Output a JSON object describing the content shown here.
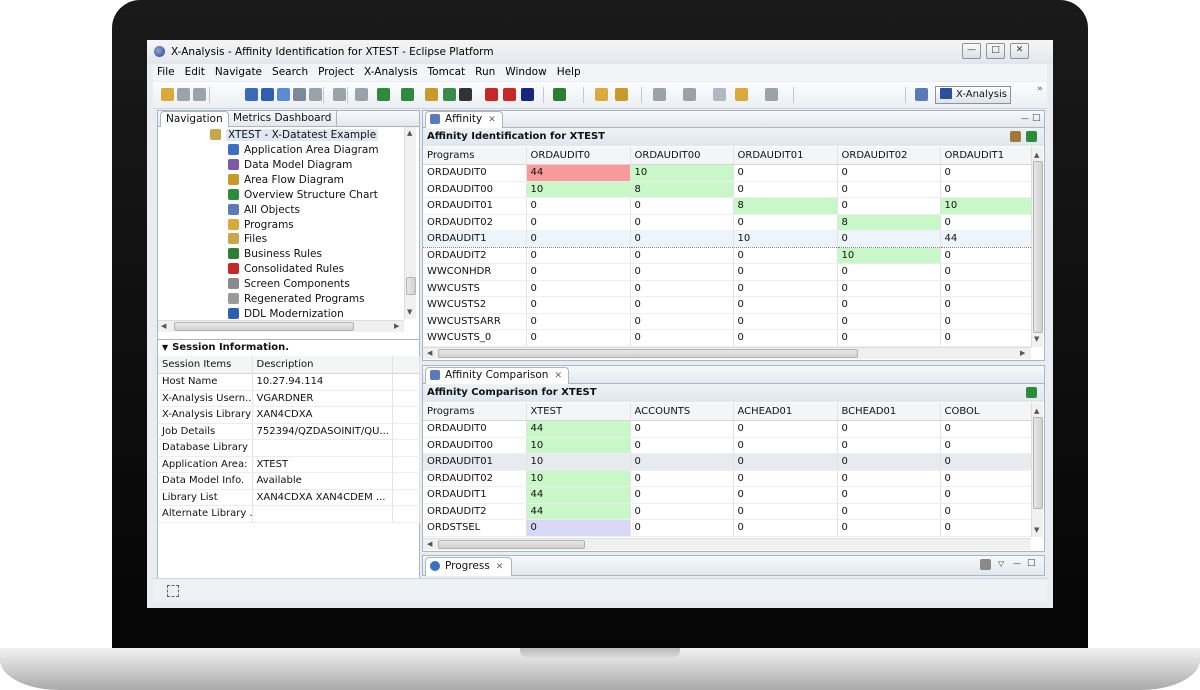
{
  "window": {
    "title": "X-Analysis - Affinity Identification for XTEST - Eclipse Platform"
  },
  "menu": [
    {
      "label": "File"
    },
    {
      "label": "Edit"
    },
    {
      "label": "Navigate"
    },
    {
      "label": "Search"
    },
    {
      "label": "Project"
    },
    {
      "label": "X-Analysis"
    },
    {
      "label": "Tomcat"
    },
    {
      "label": "Run"
    },
    {
      "label": "Window"
    },
    {
      "label": "Help"
    }
  ],
  "toolbar": {
    "perspective_label": "X-Analysis"
  },
  "navigation": {
    "tabs": [
      {
        "label": "Navigation"
      },
      {
        "label": "Metrics Dashboard"
      }
    ],
    "root": "XTEST - X-Datatest Example",
    "items": [
      {
        "label": "Application Area Diagram",
        "icon": "diagram-icon"
      },
      {
        "label": "Data Model Diagram",
        "icon": "data-model-icon"
      },
      {
        "label": "Area Flow Diagram",
        "icon": "flow-icon"
      },
      {
        "label": "Overview Structure Chart",
        "icon": "structure-icon"
      },
      {
        "label": "All Objects",
        "icon": "objects-icon"
      },
      {
        "label": "Programs",
        "icon": "programs-icon"
      },
      {
        "label": "Files",
        "icon": "files-icon"
      },
      {
        "label": "Business Rules",
        "icon": "rules-icon"
      },
      {
        "label": "Consolidated Rules",
        "icon": "consolidated-icon"
      },
      {
        "label": "Screen Components",
        "icon": "screen-icon"
      },
      {
        "label": "Regenerated Programs",
        "icon": "regen-icon"
      },
      {
        "label": "DDL Modernization",
        "icon": "ddl-icon"
      }
    ]
  },
  "session": {
    "title": "Session Information.",
    "headers": [
      "Session Items",
      "Description"
    ],
    "rows": [
      [
        "Host Name",
        "10.27.94.114"
      ],
      [
        "X-Analysis Usern...",
        "VGARDNER"
      ],
      [
        "X-Analysis Library",
        "XAN4CDXA"
      ],
      [
        "Job Details",
        "752394/QZDASOINIT/QU..."
      ],
      [
        "Database Library",
        ""
      ],
      [
        "Application Area:",
        "XTEST"
      ],
      [
        "Data Model Info.",
        "Available"
      ],
      [
        "Library List",
        "XAN4CDXA XAN4CDEM ..."
      ],
      [
        "Alternate Library ...",
        ""
      ]
    ]
  },
  "affinity": {
    "tab_label": "Affinity",
    "title": "Affinity Identification for XTEST",
    "headers": [
      "Programs",
      "ORDAUDIT0",
      "ORDAUDIT00",
      "ORDAUDIT01",
      "ORDAUDIT02",
      "ORDAUDIT1"
    ],
    "rows": [
      [
        "ORDAUDIT0",
        "44",
        "10",
        "0",
        "0",
        "0"
      ],
      [
        "ORDAUDIT00",
        "10",
        "8",
        "0",
        "0",
        "0"
      ],
      [
        "ORDAUDIT01",
        "0",
        "0",
        "8",
        "0",
        "10"
      ],
      [
        "ORDAUDIT02",
        "0",
        "0",
        "0",
        "8",
        "0"
      ],
      [
        "ORDAUDIT1",
        "0",
        "0",
        "10",
        "0",
        "44"
      ],
      [
        "ORDAUDIT2",
        "0",
        "0",
        "0",
        "10",
        "0"
      ],
      [
        "WWCONHDR",
        "0",
        "0",
        "0",
        "0",
        "0"
      ],
      [
        "WWCUSTS",
        "0",
        "0",
        "0",
        "0",
        "0"
      ],
      [
        "WWCUSTS2",
        "0",
        "0",
        "0",
        "0",
        "0"
      ],
      [
        "WWCUSTSARR",
        "0",
        "0",
        "0",
        "0",
        "0"
      ],
      [
        "WWCUSTS_0",
        "0",
        "0",
        "0",
        "0",
        "0"
      ]
    ],
    "highlights": [
      {
        "row": 0,
        "col": 1,
        "color": "red"
      },
      {
        "row": 0,
        "col": 2,
        "color": "green"
      },
      {
        "row": 1,
        "col": 1,
        "color": "green"
      },
      {
        "row": 1,
        "col": 2,
        "color": "green"
      },
      {
        "row": 2,
        "col": 3,
        "color": "green"
      },
      {
        "row": 2,
        "col": 5,
        "color": "green"
      },
      {
        "row": 3,
        "col": 4,
        "color": "green"
      },
      {
        "row": 5,
        "col": 4,
        "color": "green"
      }
    ],
    "selected_row": 4
  },
  "comparison": {
    "tab_label": "Affinity Comparison",
    "title": "Affinity Comparison for XTEST",
    "headers": [
      "Programs",
      "XTEST",
      "ACCOUNTS",
      "ACHEAD01",
      "BCHEAD01",
      "COBOL"
    ],
    "rows": [
      [
        "ORDAUDIT0",
        "44",
        "0",
        "0",
        "0",
        "0"
      ],
      [
        "ORDAUDIT00",
        "10",
        "0",
        "0",
        "0",
        "0"
      ],
      [
        "ORDAUDIT01",
        "10",
        "0",
        "0",
        "0",
        "0"
      ],
      [
        "ORDAUDIT02",
        "10",
        "0",
        "0",
        "0",
        "0"
      ],
      [
        "ORDAUDIT1",
        "44",
        "0",
        "0",
        "0",
        "0"
      ],
      [
        "ORDAUDIT2",
        "44",
        "0",
        "0",
        "0",
        "0"
      ],
      [
        "ORDSTSEL",
        "0",
        "0",
        "0",
        "0",
        "0"
      ]
    ],
    "highlights": [
      {
        "row": 0,
        "col": 1,
        "color": "green"
      },
      {
        "row": 1,
        "col": 1,
        "color": "green"
      },
      {
        "row": 3,
        "col": 1,
        "color": "green"
      },
      {
        "row": 4,
        "col": 1,
        "color": "green"
      },
      {
        "row": 5,
        "col": 1,
        "color": "green"
      },
      {
        "row": 6,
        "col": 1,
        "color": "purple"
      }
    ],
    "grey_row": 2
  },
  "progress": {
    "tab_label": "Progress"
  },
  "colors": {
    "highlight_red": "#f89a9a",
    "highlight_green": "#c8f7c8",
    "highlight_purple": "#d8d8f6",
    "pane_border": "#a9b6c4"
  }
}
